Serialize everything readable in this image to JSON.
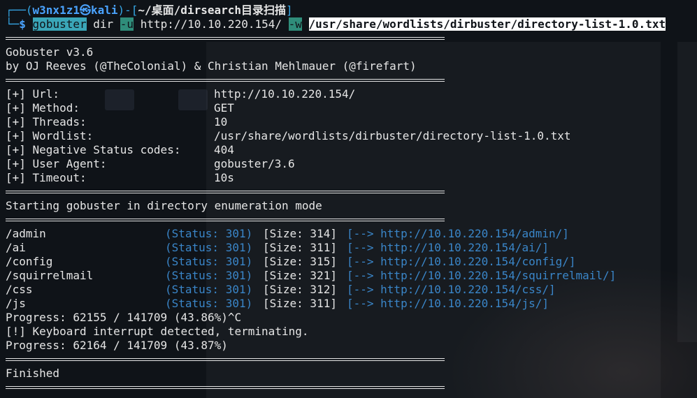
{
  "prompt": {
    "user_host": "w3nx1z1㉿kali",
    "cwd": "~/桌面/dirsearch目录扫描",
    "symbol": "$",
    "cmd": "gobuster",
    "sub": "dir",
    "flag_u": "-u",
    "url": "http://10.10.220.154/",
    "flag_w": "-w",
    "wordlist": "/usr/share/wordlists/dirbuster/directory-list-1.0.txt"
  },
  "banner": {
    "version": "Gobuster v3.6",
    "authors": "by OJ Reeves (@TheColonial) & Christian Mehlmauer (@firefart)"
  },
  "config": [
    {
      "label": "[+] Url:",
      "value": "http://10.10.220.154/"
    },
    {
      "label": "[+] Method:",
      "value": "GET"
    },
    {
      "label": "[+] Threads:",
      "value": "10"
    },
    {
      "label": "[+] Wordlist:",
      "value": "/usr/share/wordlists/dirbuster/directory-list-1.0.txt"
    },
    {
      "label": "[+] Negative Status codes:",
      "value": "404"
    },
    {
      "label": "[+] User Agent:",
      "value": "gobuster/3.6"
    },
    {
      "label": "[+] Timeout:",
      "value": "10s"
    }
  ],
  "start_msg": "Starting gobuster in directory enumeration mode",
  "results": [
    {
      "path": "/admin",
      "status": "(Status: 301)",
      "size": "[Size: 314]",
      "redirect": "[--> http://10.10.220.154/admin/]"
    },
    {
      "path": "/ai",
      "status": "(Status: 301)",
      "size": "[Size: 311]",
      "redirect": "[--> http://10.10.220.154/ai/]"
    },
    {
      "path": "/config",
      "status": "(Status: 301)",
      "size": "[Size: 315]",
      "redirect": "[--> http://10.10.220.154/config/]"
    },
    {
      "path": "/squirrelmail",
      "status": "(Status: 301)",
      "size": "[Size: 321]",
      "redirect": "[--> http://10.10.220.154/squirrelmail/]"
    },
    {
      "path": "/css",
      "status": "(Status: 301)",
      "size": "[Size: 312]",
      "redirect": "[--> http://10.10.220.154/css/]"
    },
    {
      "path": "/js",
      "status": "(Status: 301)",
      "size": "[Size: 311]",
      "redirect": "[--> http://10.10.220.154/js/]"
    }
  ],
  "progress1": "Progress: 62155 / 141709 (43.86%)^C",
  "interrupt": "[!] Keyboard interrupt detected, terminating.",
  "progress2": "Progress: 62164 / 141709 (43.87%)",
  "finished": "Finished",
  "colors": {
    "background": "#0f1318",
    "prompt": "#35a7e6",
    "status": "#3a86c9"
  }
}
